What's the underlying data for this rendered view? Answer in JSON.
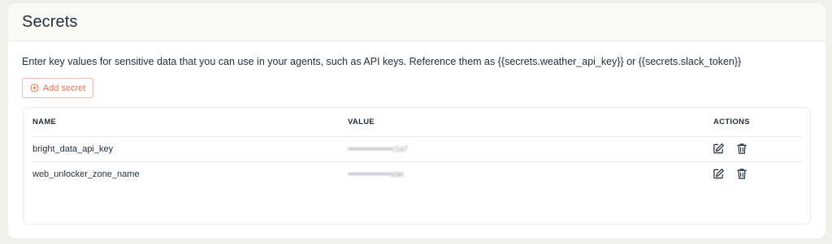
{
  "page": {
    "title": "Secrets",
    "description": "Enter key values for sensitive data that you can use in your agents, such as API keys. Reference them as {{secrets.weather_api_key}} or {{secrets.slack_token}}",
    "add_button_label": "Add secret"
  },
  "table": {
    "headers": {
      "name": "NAME",
      "value": "VALUE",
      "actions": "ACTIONS"
    },
    "rows": [
      {
        "name": "bright_data_api_key",
        "value": "••••••••••••••••••c1a7"
      },
      {
        "name": "web_unlocker_zone_name",
        "value": "••••••••••••••••••zae"
      }
    ]
  },
  "icons": {
    "add": "plus-circle-icon",
    "edit": "edit-icon",
    "delete": "trash-icon"
  },
  "colors": {
    "accent": "#e8704d",
    "accent_border": "#f3b8a5",
    "text": "#1f2d3a",
    "background": "#f1efe9"
  }
}
